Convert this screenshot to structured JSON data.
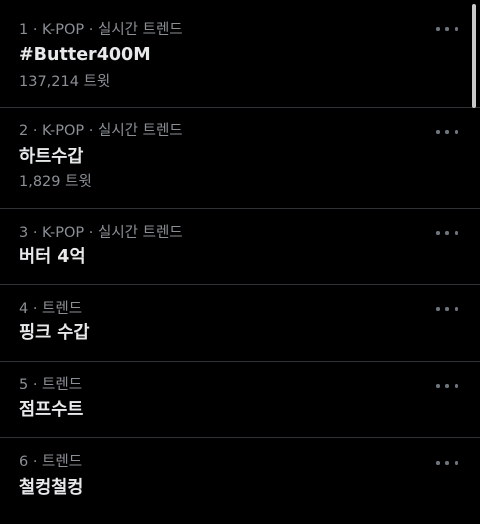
{
  "trends": [
    {
      "context": "1 · K-POP · 실시간 트렌드",
      "name": "#Butter400M",
      "count": "137,214 트윗"
    },
    {
      "context": "2 · K-POP · 실시간 트렌드",
      "name": "하트수갑",
      "count": "1,829 트윗"
    },
    {
      "context": "3 · K-POP · 실시간 트렌드",
      "name": "버터 4억",
      "count": ""
    },
    {
      "context": "4 · 트렌드",
      "name": "핑크 수갑",
      "count": ""
    },
    {
      "context": "5 · 트렌드",
      "name": "점프수트",
      "count": ""
    },
    {
      "context": "6 · 트렌드",
      "name": "철컹철컹",
      "count": ""
    }
  ],
  "icons": {
    "more": "more-horizontal-icon"
  },
  "colors": {
    "background": "#000000",
    "primary_text": "#e7e9ea",
    "secondary_text": "#8b9096",
    "divider": "#2f3336"
  }
}
